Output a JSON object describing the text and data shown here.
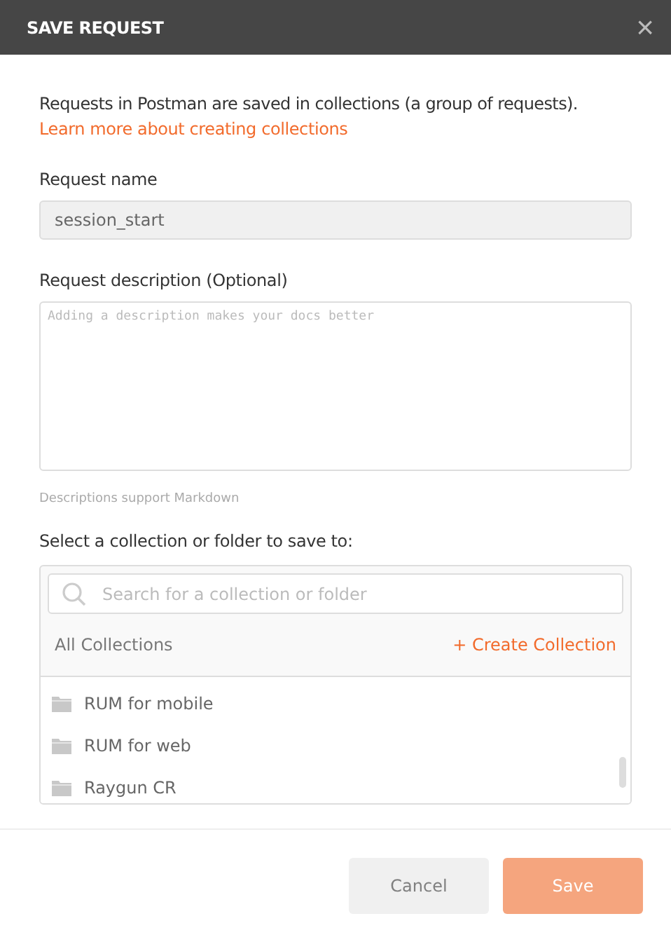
{
  "dialog": {
    "title": "SAVE REQUEST",
    "close": "×"
  },
  "intro": {
    "text": "Requests in Postman are saved in collections (a group of requests).",
    "link": "Learn more about creating collections"
  },
  "name_field": {
    "label": "Request name",
    "value": "session_start"
  },
  "description_field": {
    "label": "Request description (Optional)",
    "placeholder": "Adding a description makes your docs better",
    "hint": "Descriptions support Markdown"
  },
  "collection_picker": {
    "label": "Select a collection or folder to save to:",
    "search_placeholder": "Search for a collection or folder",
    "heading": "All Collections",
    "create": "+ Create Collection",
    "items": [
      {
        "name": "RUM for mobile"
      },
      {
        "name": "RUM for web"
      },
      {
        "name": "Raygun CR"
      }
    ]
  },
  "buttons": [
    {
      "label": "Cancel",
      "kind": "secondary",
      "disabled": false
    },
    {
      "label": "Save",
      "kind": "primary",
      "disabled": true
    }
  ]
}
